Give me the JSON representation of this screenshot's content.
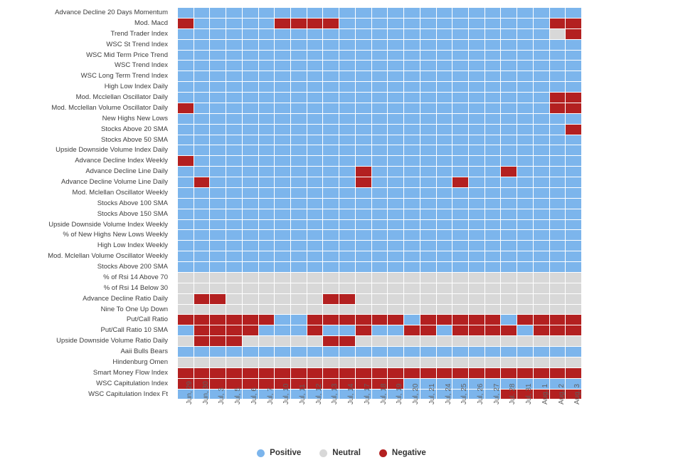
{
  "chart_data": {
    "type": "heatmap",
    "title": "",
    "xlabel": "",
    "ylabel": "",
    "legend_position": "bottom",
    "grid": true,
    "value_labels": [
      "Positive",
      "Neutral",
      "Negative"
    ],
    "value_colors": {
      "Positive": "#7cb5ec",
      "Neutral": "#d8d8d8",
      "Negative": "#b32020"
    },
    "x": [
      "Jun, 29",
      "Jun, 30",
      "Jul, 3",
      "Jul, 5",
      "Jul, 6",
      "Jul, 7",
      "Jul, 10",
      "Jul, 11",
      "Jul, 12",
      "Jul, 13",
      "Jul, 14",
      "Jul, 17",
      "Jul, 18",
      "Jul, 19",
      "Jul, 20",
      "Jul, 21",
      "Jul, 24",
      "Jul, 25",
      "Jul, 26",
      "Jul, 27",
      "Jul, 28",
      "Jul, 31",
      "Aug, 1",
      "Aug, 2",
      "Aug, 3"
    ],
    "y": [
      "Advance Decline 20 Days Momentum",
      "Mod. Macd",
      "Trend Trader Index",
      "WSC St Trend Index",
      "WSC Mid Term Price Trend",
      "WSC Trend Index",
      "WSC Long Term Trend Index",
      "High Low Index Daily",
      "Mod. Mcclellan Oscillator Daily",
      "Mod. Mcclellan Volume Oscillator Daily",
      "New Highs New Lows",
      "Stocks Above 20 SMA",
      "Stocks Above 50 SMA",
      "Upside Downside Volume Index Daily",
      "Advance Decline Index Weekly",
      "Advance Decline Line Daily",
      "Advance Decline Volume Line Daily",
      "Mod. Mclellan Oscillator Weekly",
      "Stocks Above 100 SMA",
      "Stocks Above 150 SMA",
      "Upside Downside Volume Index Weekly",
      "% of New Highs New Lows Weekly",
      "High Low Index Weekly",
      "Mod. Mclellan Volume Oscillator Weekly",
      "Stocks Above 200 SMA",
      "% of Rsi 14 Above 70",
      "% of Rsi 14 Below 30",
      "Advance Decline Ratio Daily",
      "Nine To One Up Down",
      "Put/Call Ratio",
      "Put/Call Ratio 10 SMA",
      "Upside Downside Volume Ratio Daily",
      "Aaii Bulls Bears",
      "Hindenburg Omen",
      "Smart Money Flow Index",
      "WSC Capitulation Index",
      "WSC Capitulation Index Ft"
    ],
    "values": [
      [
        "P",
        "P",
        "P",
        "P",
        "P",
        "P",
        "P",
        "P",
        "P",
        "P",
        "P",
        "P",
        "P",
        "P",
        "P",
        "P",
        "P",
        "P",
        "P",
        "P",
        "P",
        "P",
        "P",
        "P",
        "P"
      ],
      [
        "N",
        "P",
        "P",
        "P",
        "P",
        "P",
        "N",
        "N",
        "N",
        "N",
        "P",
        "P",
        "P",
        "P",
        "P",
        "P",
        "P",
        "P",
        "P",
        "P",
        "P",
        "P",
        "P",
        "N",
        "N"
      ],
      [
        "P",
        "P",
        "P",
        "P",
        "P",
        "P",
        "P",
        "P",
        "P",
        "P",
        "P",
        "P",
        "P",
        "P",
        "P",
        "P",
        "P",
        "P",
        "P",
        "P",
        "P",
        "P",
        "P",
        "U",
        "N"
      ],
      [
        "P",
        "P",
        "P",
        "P",
        "P",
        "P",
        "P",
        "P",
        "P",
        "P",
        "P",
        "P",
        "P",
        "P",
        "P",
        "P",
        "P",
        "P",
        "P",
        "P",
        "P",
        "P",
        "P",
        "P",
        "P"
      ],
      [
        "P",
        "P",
        "P",
        "P",
        "P",
        "P",
        "P",
        "P",
        "P",
        "P",
        "P",
        "P",
        "P",
        "P",
        "P",
        "P",
        "P",
        "P",
        "P",
        "P",
        "P",
        "P",
        "P",
        "P",
        "P"
      ],
      [
        "P",
        "P",
        "P",
        "P",
        "P",
        "P",
        "P",
        "P",
        "P",
        "P",
        "P",
        "P",
        "P",
        "P",
        "P",
        "P",
        "P",
        "P",
        "P",
        "P",
        "P",
        "P",
        "P",
        "P",
        "P"
      ],
      [
        "P",
        "P",
        "P",
        "P",
        "P",
        "P",
        "P",
        "P",
        "P",
        "P",
        "P",
        "P",
        "P",
        "P",
        "P",
        "P",
        "P",
        "P",
        "P",
        "P",
        "P",
        "P",
        "P",
        "P",
        "P"
      ],
      [
        "P",
        "P",
        "P",
        "P",
        "P",
        "P",
        "P",
        "P",
        "P",
        "P",
        "P",
        "P",
        "P",
        "P",
        "P",
        "P",
        "P",
        "P",
        "P",
        "P",
        "P",
        "P",
        "P",
        "P",
        "P"
      ],
      [
        "P",
        "P",
        "P",
        "P",
        "P",
        "P",
        "P",
        "P",
        "P",
        "P",
        "P",
        "P",
        "P",
        "P",
        "P",
        "P",
        "P",
        "P",
        "P",
        "P",
        "P",
        "P",
        "P",
        "N",
        "N"
      ],
      [
        "N",
        "P",
        "P",
        "P",
        "P",
        "P",
        "P",
        "P",
        "P",
        "P",
        "P",
        "P",
        "P",
        "P",
        "P",
        "P",
        "P",
        "P",
        "P",
        "P",
        "P",
        "P",
        "P",
        "N",
        "N"
      ],
      [
        "P",
        "P",
        "P",
        "P",
        "P",
        "P",
        "P",
        "P",
        "P",
        "P",
        "P",
        "P",
        "P",
        "P",
        "P",
        "P",
        "P",
        "P",
        "P",
        "P",
        "P",
        "P",
        "P",
        "P",
        "P"
      ],
      [
        "P",
        "P",
        "P",
        "P",
        "P",
        "P",
        "P",
        "P",
        "P",
        "P",
        "P",
        "P",
        "P",
        "P",
        "P",
        "P",
        "P",
        "P",
        "P",
        "P",
        "P",
        "P",
        "P",
        "P",
        "N"
      ],
      [
        "P",
        "P",
        "P",
        "P",
        "P",
        "P",
        "P",
        "P",
        "P",
        "P",
        "P",
        "P",
        "P",
        "P",
        "P",
        "P",
        "P",
        "P",
        "P",
        "P",
        "P",
        "P",
        "P",
        "P",
        "P"
      ],
      [
        "P",
        "P",
        "P",
        "P",
        "P",
        "P",
        "P",
        "P",
        "P",
        "P",
        "P",
        "P",
        "P",
        "P",
        "P",
        "P",
        "P",
        "P",
        "P",
        "P",
        "P",
        "P",
        "P",
        "P",
        "P"
      ],
      [
        "N",
        "P",
        "P",
        "P",
        "P",
        "P",
        "P",
        "P",
        "P",
        "P",
        "P",
        "P",
        "P",
        "P",
        "P",
        "P",
        "P",
        "P",
        "P",
        "P",
        "P",
        "P",
        "P",
        "P",
        "P"
      ],
      [
        "P",
        "P",
        "P",
        "P",
        "P",
        "P",
        "P",
        "P",
        "P",
        "P",
        "P",
        "N",
        "P",
        "P",
        "P",
        "P",
        "P",
        "P",
        "P",
        "P",
        "N",
        "P",
        "P",
        "P",
        "P"
      ],
      [
        "P",
        "N",
        "P",
        "P",
        "P",
        "P",
        "P",
        "P",
        "P",
        "P",
        "P",
        "N",
        "P",
        "P",
        "P",
        "P",
        "P",
        "N",
        "P",
        "P",
        "P",
        "P",
        "P",
        "P",
        "P"
      ],
      [
        "P",
        "P",
        "P",
        "P",
        "P",
        "P",
        "P",
        "P",
        "P",
        "P",
        "P",
        "P",
        "P",
        "P",
        "P",
        "P",
        "P",
        "P",
        "P",
        "P",
        "P",
        "P",
        "P",
        "P",
        "P"
      ],
      [
        "P",
        "P",
        "P",
        "P",
        "P",
        "P",
        "P",
        "P",
        "P",
        "P",
        "P",
        "P",
        "P",
        "P",
        "P",
        "P",
        "P",
        "P",
        "P",
        "P",
        "P",
        "P",
        "P",
        "P",
        "P"
      ],
      [
        "P",
        "P",
        "P",
        "P",
        "P",
        "P",
        "P",
        "P",
        "P",
        "P",
        "P",
        "P",
        "P",
        "P",
        "P",
        "P",
        "P",
        "P",
        "P",
        "P",
        "P",
        "P",
        "P",
        "P",
        "P"
      ],
      [
        "P",
        "P",
        "P",
        "P",
        "P",
        "P",
        "P",
        "P",
        "P",
        "P",
        "P",
        "P",
        "P",
        "P",
        "P",
        "P",
        "P",
        "P",
        "P",
        "P",
        "P",
        "P",
        "P",
        "P",
        "P"
      ],
      [
        "P",
        "P",
        "P",
        "P",
        "P",
        "P",
        "P",
        "P",
        "P",
        "P",
        "P",
        "P",
        "P",
        "P",
        "P",
        "P",
        "P",
        "P",
        "P",
        "P",
        "P",
        "P",
        "P",
        "P",
        "P"
      ],
      [
        "P",
        "P",
        "P",
        "P",
        "P",
        "P",
        "P",
        "P",
        "P",
        "P",
        "P",
        "P",
        "P",
        "P",
        "P",
        "P",
        "P",
        "P",
        "P",
        "P",
        "P",
        "P",
        "P",
        "P",
        "P"
      ],
      [
        "P",
        "P",
        "P",
        "P",
        "P",
        "P",
        "P",
        "P",
        "P",
        "P",
        "P",
        "P",
        "P",
        "P",
        "P",
        "P",
        "P",
        "P",
        "P",
        "P",
        "P",
        "P",
        "P",
        "P",
        "P"
      ],
      [
        "P",
        "P",
        "P",
        "P",
        "P",
        "P",
        "P",
        "P",
        "P",
        "P",
        "P",
        "P",
        "P",
        "P",
        "P",
        "P",
        "P",
        "P",
        "P",
        "P",
        "P",
        "P",
        "P",
        "P",
        "P"
      ],
      [
        "U",
        "U",
        "U",
        "U",
        "U",
        "U",
        "U",
        "U",
        "U",
        "U",
        "U",
        "U",
        "U",
        "U",
        "U",
        "U",
        "U",
        "U",
        "U",
        "U",
        "U",
        "U",
        "U",
        "U",
        "U"
      ],
      [
        "U",
        "U",
        "U",
        "U",
        "U",
        "U",
        "U",
        "U",
        "U",
        "U",
        "U",
        "U",
        "U",
        "U",
        "U",
        "U",
        "U",
        "U",
        "U",
        "U",
        "U",
        "U",
        "U",
        "U",
        "U"
      ],
      [
        "U",
        "N",
        "N",
        "U",
        "U",
        "U",
        "U",
        "U",
        "U",
        "N",
        "N",
        "U",
        "U",
        "U",
        "U",
        "U",
        "U",
        "U",
        "U",
        "U",
        "U",
        "U",
        "U",
        "U",
        "U"
      ],
      [
        "U",
        "U",
        "U",
        "U",
        "U",
        "U",
        "U",
        "U",
        "U",
        "U",
        "U",
        "U",
        "U",
        "U",
        "U",
        "U",
        "U",
        "U",
        "U",
        "U",
        "U",
        "U",
        "U",
        "U",
        "U"
      ],
      [
        "N",
        "N",
        "N",
        "N",
        "N",
        "N",
        "P",
        "P",
        "N",
        "N",
        "N",
        "N",
        "N",
        "N",
        "P",
        "N",
        "N",
        "N",
        "N",
        "N",
        "P",
        "N",
        "N",
        "N",
        "N"
      ],
      [
        "P",
        "N",
        "N",
        "N",
        "N",
        "P",
        "P",
        "P",
        "N",
        "P",
        "P",
        "N",
        "P",
        "P",
        "N",
        "N",
        "P",
        "N",
        "N",
        "N",
        "N",
        "P",
        "N",
        "N",
        "N"
      ],
      [
        "U",
        "N",
        "N",
        "N",
        "U",
        "U",
        "U",
        "U",
        "U",
        "N",
        "N",
        "U",
        "U",
        "U",
        "U",
        "U",
        "U",
        "U",
        "U",
        "U",
        "U",
        "U",
        "U",
        "U",
        "U"
      ],
      [
        "P",
        "P",
        "P",
        "P",
        "P",
        "P",
        "P",
        "P",
        "P",
        "P",
        "P",
        "P",
        "P",
        "P",
        "P",
        "P",
        "P",
        "P",
        "P",
        "P",
        "P",
        "P",
        "P",
        "P",
        "P"
      ],
      [
        "U",
        "U",
        "U",
        "U",
        "U",
        "U",
        "U",
        "U",
        "U",
        "U",
        "U",
        "U",
        "U",
        "U",
        "U",
        "U",
        "U",
        "U",
        "U",
        "U",
        "U",
        "U",
        "U",
        "U",
        "U"
      ],
      [
        "N",
        "N",
        "N",
        "N",
        "N",
        "N",
        "N",
        "N",
        "N",
        "N",
        "N",
        "N",
        "N",
        "N",
        "N",
        "N",
        "N",
        "N",
        "N",
        "N",
        "N",
        "N",
        "N",
        "N",
        "N"
      ],
      [
        "N",
        "N",
        "N",
        "N",
        "N",
        "N",
        "N",
        "N",
        "N",
        "N",
        "N",
        "N",
        "N",
        "N",
        "P",
        "P",
        "P",
        "P",
        "P",
        "P",
        "P",
        "P",
        "P",
        "P",
        "P"
      ],
      [
        "P",
        "P",
        "P",
        "P",
        "P",
        "P",
        "P",
        "P",
        "P",
        "P",
        "P",
        "P",
        "P",
        "P",
        "P",
        "P",
        "P",
        "P",
        "P",
        "P",
        "N",
        "N",
        "N",
        "N",
        "N"
      ]
    ]
  },
  "legend": {
    "items": [
      {
        "label": "Positive",
        "color": "#7cb5ec",
        "key": "P"
      },
      {
        "label": "Neutral",
        "color": "#d8d8d8",
        "key": "U"
      },
      {
        "label": "Negative",
        "color": "#b32020",
        "key": "N"
      }
    ]
  }
}
